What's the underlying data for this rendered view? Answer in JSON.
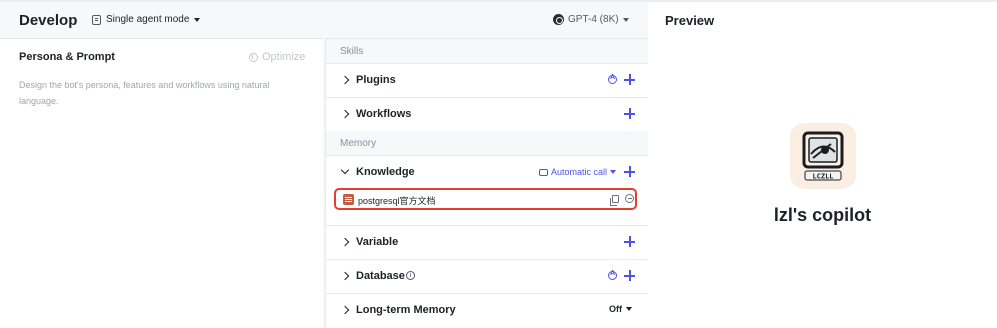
{
  "develop": {
    "title": "Develop",
    "mode_label": "Single agent mode",
    "model_label": "GPT-4 (8K)"
  },
  "persona": {
    "title": "Persona & Prompt",
    "optimize_label": "Optimize",
    "description": "Design the bot's persona, features and workflows using natural language."
  },
  "skills": {
    "section_label": "Skills",
    "plugins_label": "Plugins",
    "workflows_label": "Workflows"
  },
  "memory": {
    "section_label": "Memory",
    "knowledge_label": "Knowledge",
    "auto_call_label": "Automatic call",
    "knowledge_item_name": "postgresql官方文档",
    "variable_label": "Variable",
    "database_label": "Database",
    "long_term_label": "Long-term Memory",
    "long_term_value": "Off"
  },
  "preview": {
    "title": "Preview",
    "bot_name": "lzl's copilot",
    "avatar_text": "LCZLL"
  },
  "colors": {
    "accent": "#4d53e8",
    "highlight_border": "#e0412f",
    "avatar_bg": "#fbeee2"
  },
  "icons": [
    "doc-icon",
    "caret-down-icon",
    "model-icon",
    "optimize-icon",
    "chevron-right-icon",
    "chevron-down-icon",
    "plus-icon",
    "auto-icon",
    "info-icon",
    "database-icon",
    "copy-icon",
    "remove-icon",
    "call-icon"
  ]
}
